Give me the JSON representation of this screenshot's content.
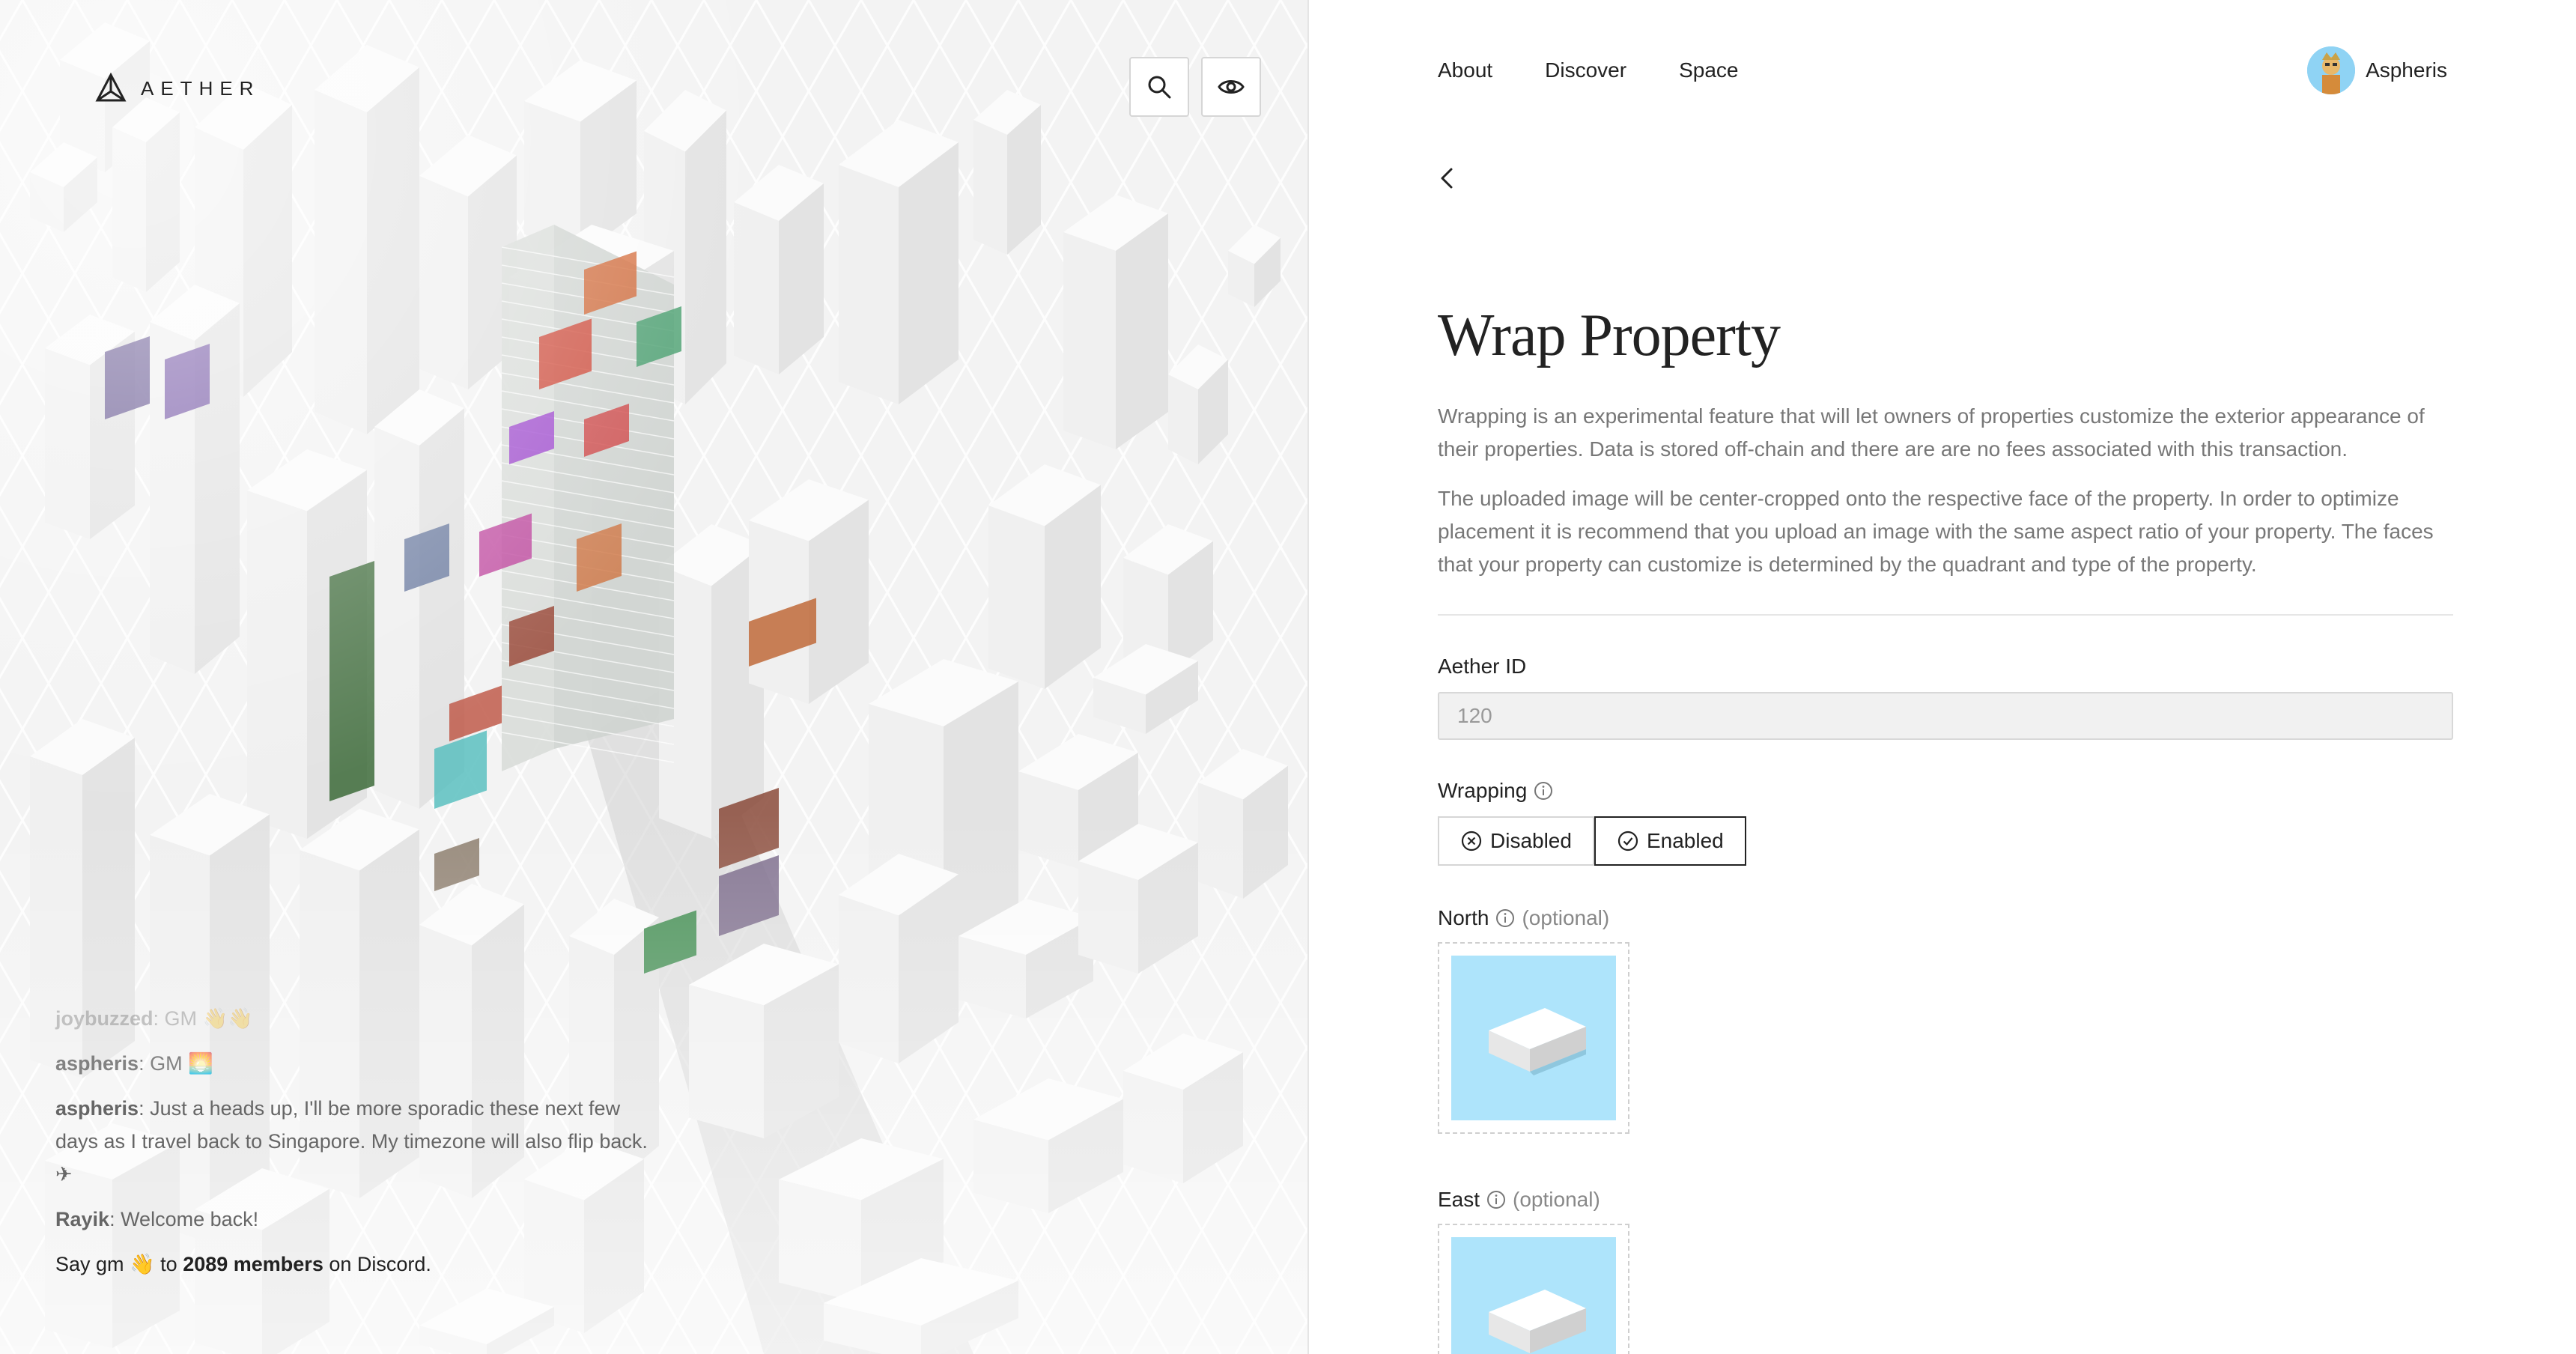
{
  "brand": {
    "name": "AETHER"
  },
  "map_controls": {
    "search_icon": "search-icon",
    "view_icon": "eye-icon"
  },
  "chat": {
    "messages": [
      {
        "user": "joybuzzed",
        "text": ": GM 👋👋"
      },
      {
        "user": "aspheris",
        "text": ": GM 🌅"
      },
      {
        "user": "aspheris",
        "text": ": Just a heads up, I'll be more sporadic these next few days as I travel back to Singapore. My timezone will also flip back. ✈"
      },
      {
        "user": "Rayik",
        "text": ": Welcome back!"
      }
    ],
    "discord": {
      "prefix": "Say gm 👋 to",
      "members": "2089 members",
      "suffix": "on Discord."
    }
  },
  "nav": {
    "items": [
      "About",
      "Discover",
      "Space"
    ],
    "user_name": "Aspheris"
  },
  "page": {
    "title": "Wrap Property",
    "desc1": "Wrapping is an experimental feature that will let owners of properties customize the exterior appearance of their properties. Data is stored off-chain and there are are no fees associated with this transaction.",
    "desc2": "The uploaded image will be center-cropped onto the respective face of the property. In order to optimize placement it is recommend that you upload an image with the same aspect ratio of your property. The faces that your property can customize is determined by the quadrant and type of the property."
  },
  "form": {
    "aether_id_label": "Aether ID",
    "aether_id_value": "120",
    "wrapping_label": "Wrapping",
    "disabled_label": "Disabled",
    "enabled_label": "Enabled",
    "wrapping_selected": "Enabled",
    "north_label": "North",
    "east_label": "East",
    "optional_text": "(optional)"
  },
  "colors": {
    "upload_bg": "#aee4fb",
    "text": "#222222",
    "muted": "#777777"
  }
}
